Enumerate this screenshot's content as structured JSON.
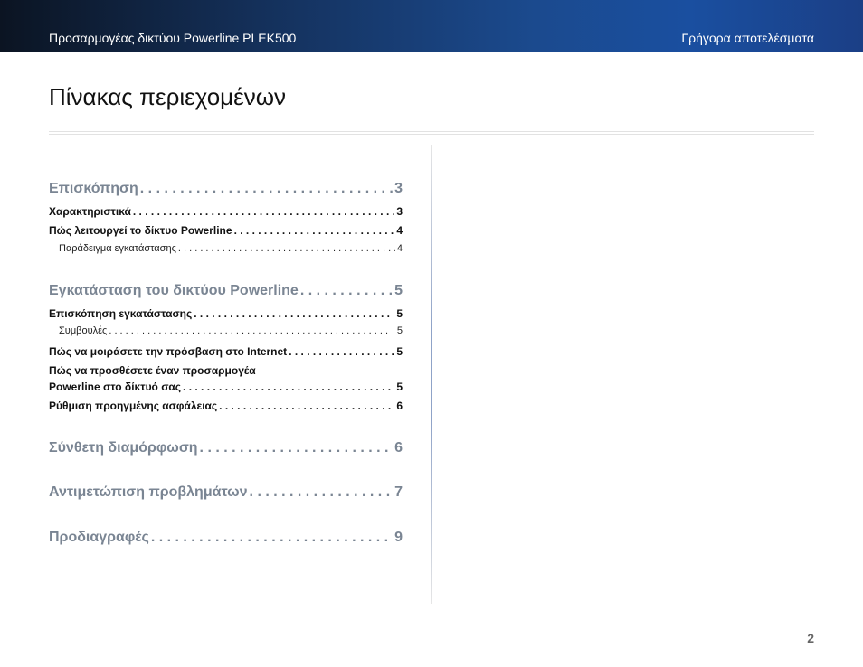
{
  "header": {
    "left_text": "Προσαρμογέας δικτύου Powerline PLEK500",
    "right_text": "Γρήγορα αποτελέσματα"
  },
  "page_title": "Πίνακας περιεχομένων",
  "toc": {
    "leader": ". . . . . . . . . . . . . . . . . . . . . . . . . . . . . . . . . . . . . . . . . . . . . . . . . . .",
    "entries": [
      {
        "label": "Επισκόπηση",
        "page": "3"
      },
      {
        "label": "Χαρακτηριστικά",
        "page": "3"
      },
      {
        "label": "Πώς λειτουργεί το δίκτυο Powerline",
        "page": "4"
      },
      {
        "label": "Παράδειγμα εγκατάστασης",
        "page": "4"
      },
      {
        "label": "Εγκατάσταση του δικτύου Powerline",
        "page": "5"
      },
      {
        "label": "Επισκόπηση εγκατάστασης",
        "page": "5"
      },
      {
        "label": "Συμβουλές",
        "page": "5"
      },
      {
        "label": "Πώς να μοιράσετε την πρόσβαση στο Internet",
        "page": "5"
      },
      {
        "label_line1": "Πώς να προσθέσετε έναν προσαρμογέα",
        "label": "Powerline στο δίκτυό σας",
        "page": "5"
      },
      {
        "label": "Ρύθμιση προηγμένης ασφάλειας",
        "page": "6"
      },
      {
        "label": "Σύνθετη διαμόρφωση",
        "page": "6"
      },
      {
        "label": "Αντιμετώπιση προβλημάτων",
        "page": "7"
      },
      {
        "label": "Προδιαγραφές",
        "page": "9"
      }
    ]
  },
  "page_number": "2"
}
